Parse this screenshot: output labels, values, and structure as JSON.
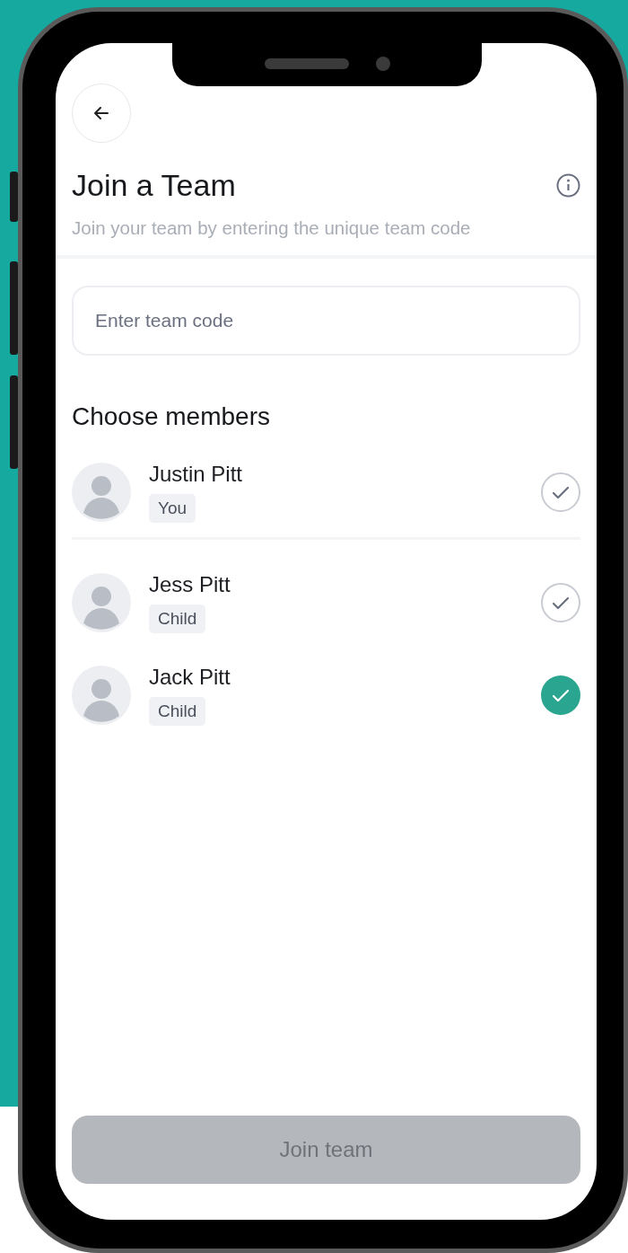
{
  "screen": {
    "title": "Join a Team",
    "subtitle": "Join your team by entering the unique team code"
  },
  "code_field": {
    "placeholder": "Enter team code"
  },
  "members_heading": "Choose members",
  "members": [
    {
      "name": "Justin Pitt",
      "tag": "You",
      "selected": false
    },
    {
      "name": "Jess Pitt",
      "tag": "Child",
      "selected": false
    },
    {
      "name": "Jack Pitt",
      "tag": "Child",
      "selected": true
    }
  ],
  "join_button": {
    "label": "Join team",
    "disabled": true
  }
}
